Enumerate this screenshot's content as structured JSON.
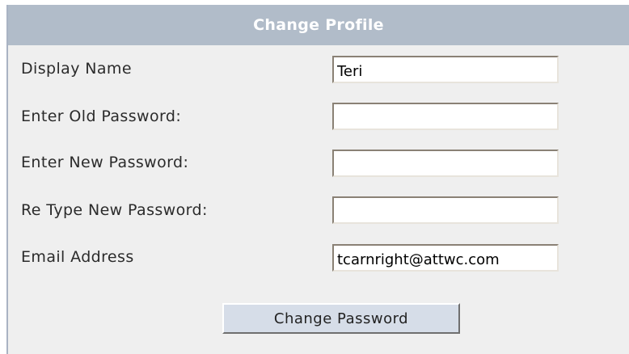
{
  "header": {
    "title": "Change Profile"
  },
  "form": {
    "display_name": {
      "label": "Display Name",
      "value": "Teri"
    },
    "old_password": {
      "label": "Enter Old Password:",
      "value": ""
    },
    "new_password": {
      "label": "Enter New Password:",
      "value": ""
    },
    "retype_password": {
      "label": "Re Type New Password:",
      "value": ""
    },
    "email": {
      "label": "Email Address",
      "value": "tcarnright@attwc.com"
    }
  },
  "actions": {
    "submit_label": "Change Password"
  },
  "colors": {
    "header_bg": "#b1bcc9",
    "panel_bg": "#efefef",
    "button_bg": "#d6dde8"
  }
}
